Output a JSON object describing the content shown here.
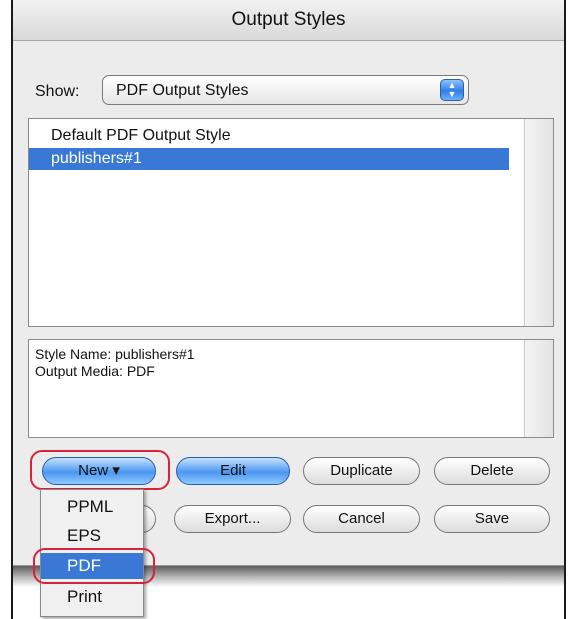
{
  "window": {
    "title": "Output Styles"
  },
  "show": {
    "label": "Show:",
    "selected": "PDF Output Styles",
    "arrows_icon": "up-down-arrows-icon"
  },
  "styles_list": [
    {
      "label": "Default PDF Output Style",
      "selected": false
    },
    {
      "label": "publishers#1",
      "selected": true
    }
  ],
  "details": {
    "style_name": "Style Name: publishers#1",
    "output_media": "Output Media: PDF"
  },
  "buttons": {
    "new": "New ▾",
    "edit": "Edit",
    "duplicate": "Duplicate",
    "delete": "Delete",
    "export": "Export...",
    "cancel": "Cancel",
    "save": "Save"
  },
  "new_menu": [
    {
      "label": "PPML",
      "selected": false
    },
    {
      "label": "EPS",
      "selected": false
    },
    {
      "label": "PDF",
      "selected": true
    },
    {
      "label": "Print",
      "selected": false
    }
  ],
  "colors": {
    "selection": "#3a78d6",
    "highlight": "#d8213a"
  }
}
